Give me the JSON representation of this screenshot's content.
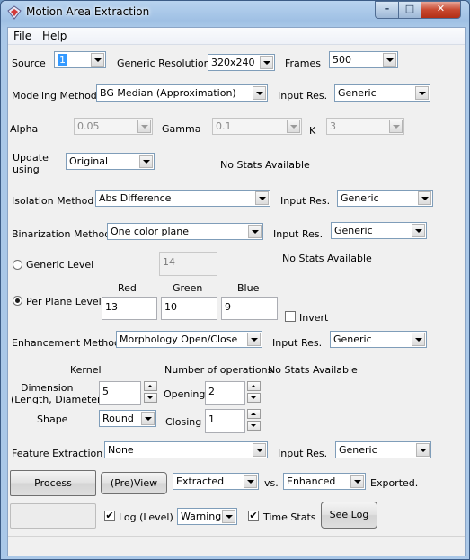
{
  "window": {
    "title": "Motion Area Extraction",
    "minimize_glyph": "–",
    "maximize_glyph": "□",
    "close_glyph": "✕"
  },
  "menu": {
    "file": "File",
    "help": "Help"
  },
  "row1": {
    "source_label": "Source",
    "source_value": "1",
    "generic_res_label": "Generic Resolution",
    "generic_res_value": "320x240",
    "frames_label": "Frames",
    "frames_value": "500"
  },
  "modeling": {
    "label": "Modeling Method",
    "value": "BG Median (Approximation)",
    "input_res_label": "Input Res.",
    "input_res_value": "Generic"
  },
  "params": {
    "alpha_label": "Alpha",
    "alpha_value": "0.05",
    "gamma_label": "Gamma",
    "gamma_value": "0.1",
    "k_label": "K",
    "k_value": "3"
  },
  "update": {
    "label_line1": "Update",
    "label_line2": "using",
    "value": "Original",
    "stats": "No Stats Available"
  },
  "isolation": {
    "label": "Isolation Method",
    "value": "Abs Difference",
    "input_res_label": "Input Res.",
    "input_res_value": "Generic"
  },
  "binarization": {
    "label": "Binarization Method",
    "value": "One color plane",
    "input_res_label": "Input Res.",
    "input_res_value": "Generic"
  },
  "generic_level": {
    "label": "Generic Level",
    "value": "14",
    "stats": "No Stats Available"
  },
  "per_plane": {
    "label": "Per Plane Level",
    "red_label": "Red",
    "green_label": "Green",
    "blue_label": "Blue",
    "red_value": "13",
    "green_value": "10",
    "blue_value": "9",
    "invert_label": "Invert"
  },
  "enhancement": {
    "label": "Enhancement Method",
    "value": "Morphology Open/Close",
    "input_res_label": "Input Res.",
    "input_res_value": "Generic"
  },
  "kernel": {
    "kernel_label": "Kernel",
    "num_ops_label": "Number of operations",
    "stats": "No Stats Available",
    "dimension_line1": "Dimension",
    "dimension_line2": "(Length, Diameter)",
    "dimension_value": "5",
    "opening_label": "Opening",
    "opening_value": "2",
    "shape_label": "Shape",
    "shape_value": "Round",
    "closing_label": "Closing",
    "closing_value": "1"
  },
  "feature": {
    "label": "Feature Extraction",
    "value": "None",
    "input_res_label": "Input Res.",
    "input_res_value": "Generic"
  },
  "actions": {
    "process_label": "Process",
    "preview_label": "(Pre)View",
    "view_a_value": "Extracted",
    "vs_label": "vs.",
    "view_b_value": "Enhanced",
    "exported_label": "Exported."
  },
  "log": {
    "log_label": "Log (Level)",
    "log_checked": "✔",
    "level_value": "Warning",
    "time_stats_label": "Time Stats",
    "time_stats_checked": "✔",
    "see_log_label": "See Log"
  }
}
